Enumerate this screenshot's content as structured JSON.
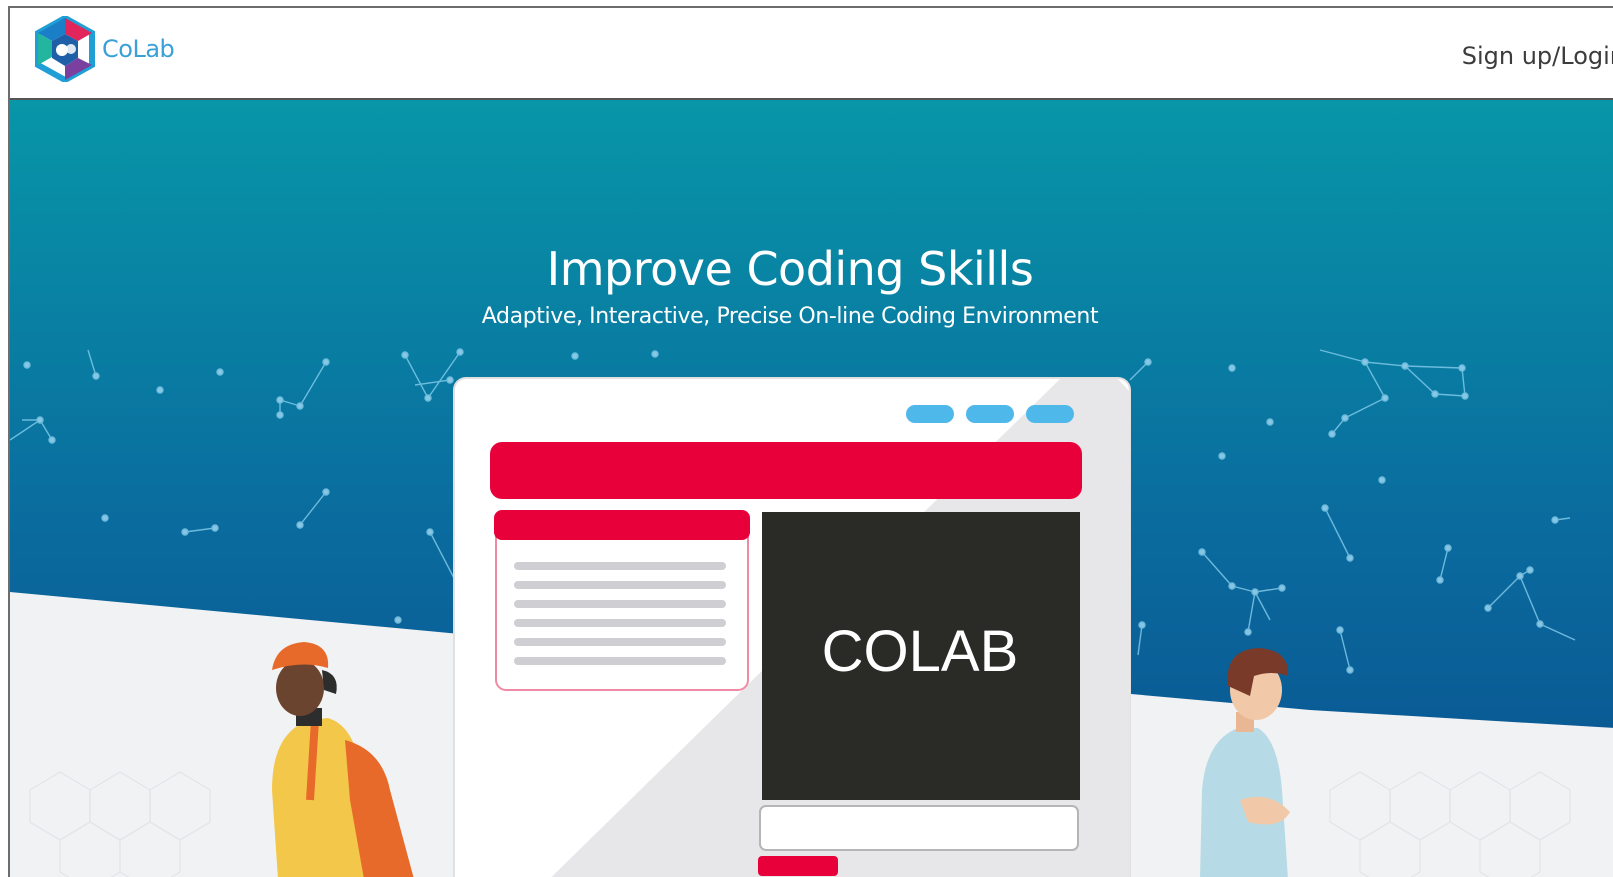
{
  "app": {
    "name": "CoLab",
    "brand_color": "#3aa0d8",
    "icon": "colab-hexagon-logo-icon"
  },
  "nav": {
    "login_label": "Sign up/Login"
  },
  "hero": {
    "title": "Improve Coding Skills",
    "subtitle": "Adaptive, Interactive, Precise On-line Coding Environment",
    "screen_label": "COLAB",
    "gradient_top": "#0896a8",
    "gradient_bottom": "#0a4f8e",
    "accent_red": "#e8003a",
    "dot_blue": "#4fb8ea"
  }
}
